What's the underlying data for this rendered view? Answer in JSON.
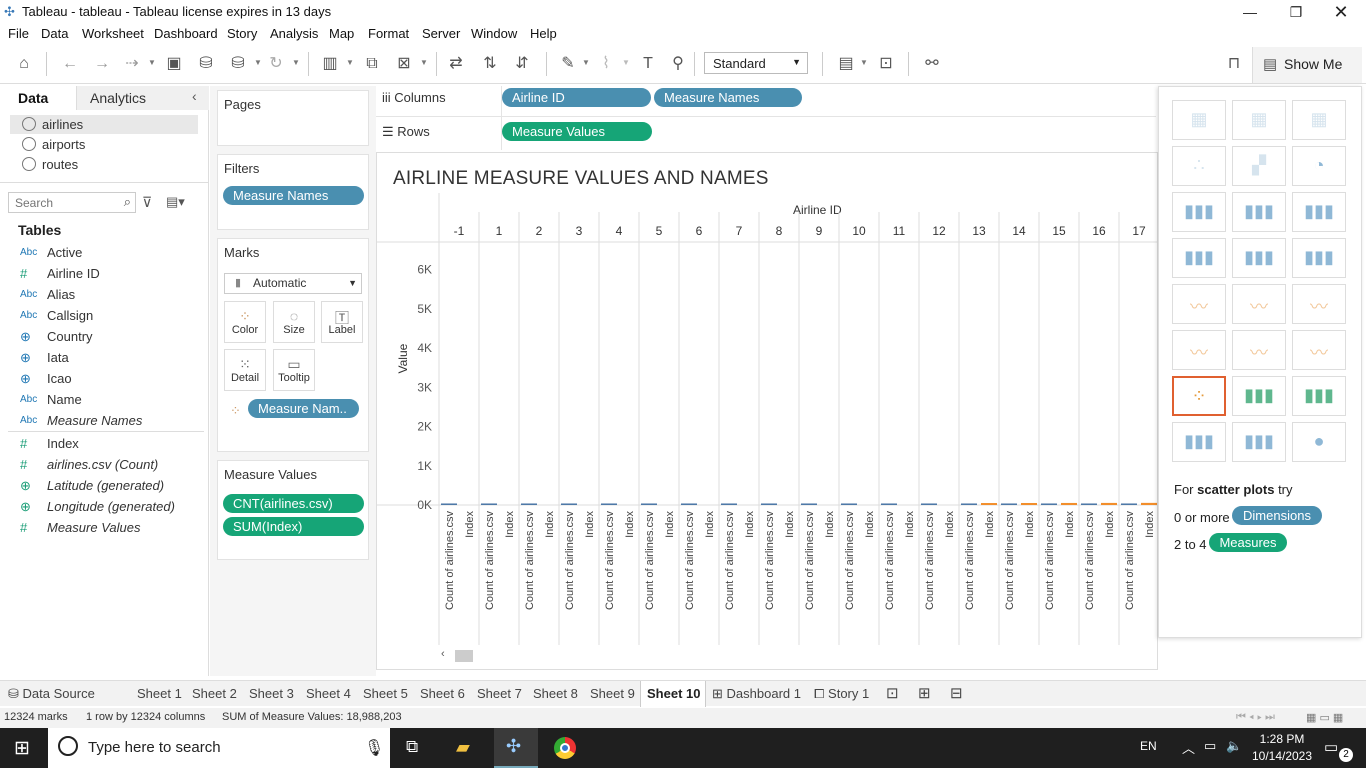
{
  "window": {
    "title": "Tableau - tableau - Tableau license expires in 13 days"
  },
  "menu": [
    "File",
    "Data",
    "Worksheet",
    "Dashboard",
    "Story",
    "Analysis",
    "Map",
    "Format",
    "Server",
    "Window",
    "Help"
  ],
  "toolbar": {
    "fit_select": "Standard",
    "show_me": "Show Me"
  },
  "left_pane": {
    "tabs": [
      "Data",
      "Analytics"
    ],
    "datasources": [
      "airlines",
      "airports",
      "routes"
    ],
    "search_placeholder": "Search",
    "tables_header": "Tables",
    "fields": [
      {
        "type": "Abc",
        "name": "Active",
        "kind": "dim",
        "italic": false
      },
      {
        "type": "#",
        "name": "Airline ID",
        "kind": "mea",
        "italic": false
      },
      {
        "type": "Abc",
        "name": "Alias",
        "kind": "dim",
        "italic": false
      },
      {
        "type": "Abc",
        "name": "Callsign",
        "kind": "dim",
        "italic": false
      },
      {
        "type": "globe",
        "name": "Country",
        "kind": "dim",
        "italic": false
      },
      {
        "type": "globe",
        "name": "Iata",
        "kind": "dim",
        "italic": false
      },
      {
        "type": "globe",
        "name": "Icao",
        "kind": "dim",
        "italic": false
      },
      {
        "type": "Abc",
        "name": "Name",
        "kind": "dim",
        "italic": false
      },
      {
        "type": "Abc",
        "name": "Measure Names",
        "kind": "dim",
        "italic": true
      },
      {
        "type": "#",
        "name": "Index",
        "kind": "mea",
        "italic": false
      },
      {
        "type": "#",
        "name": "airlines.csv (Count)",
        "kind": "mea",
        "italic": true
      },
      {
        "type": "globe",
        "name": "Latitude (generated)",
        "kind": "mea",
        "italic": true
      },
      {
        "type": "globe",
        "name": "Longitude (generated)",
        "kind": "mea",
        "italic": true
      },
      {
        "type": "#",
        "name": "Measure Values",
        "kind": "mea",
        "italic": true
      }
    ]
  },
  "cards": {
    "pages": "Pages",
    "filters": "Filters",
    "filter_pill": "Measure Names",
    "marks": "Marks",
    "mark_type": "Automatic",
    "mark_buttons": [
      "Color",
      "Size",
      "Label",
      "Detail",
      "Tooltip"
    ],
    "marks_pill": "Measure Nam..",
    "measure_values": "Measure Values",
    "mv_pills": [
      "CNT(airlines.csv)",
      "SUM(Index)"
    ]
  },
  "shelves": {
    "columns_label": "Columns",
    "rows_label": "Rows",
    "columns_pills": [
      "Airline ID",
      "Measure Names"
    ],
    "rows_pills": [
      "Measure Values"
    ]
  },
  "view": {
    "title": "AIRLINE MEASURE VALUES AND NAMES"
  },
  "chart_data": {
    "type": "bar",
    "title": "AIRLINE MEASURE VALUES AND NAMES",
    "xlabel": "Airline ID",
    "ylabel": "Value",
    "categories": [
      "-1",
      "1",
      "2",
      "3",
      "4",
      "5",
      "6",
      "7",
      "8",
      "9",
      "10",
      "11",
      "12",
      "13",
      "14",
      "15",
      "16",
      "17"
    ],
    "subcategories": [
      "Count of airlines.csv",
      "Index"
    ],
    "y_ticks": [
      "0K",
      "1K",
      "2K",
      "3K",
      "4K",
      "5K",
      "6K"
    ],
    "ylim": [
      0,
      6500
    ],
    "series": [
      {
        "name": "Count of airlines.csv",
        "values": [
          1,
          1,
          1,
          1,
          1,
          1,
          1,
          1,
          1,
          1,
          1,
          1,
          1,
          1,
          1,
          1,
          1,
          1
        ]
      },
      {
        "name": "Index",
        "values": [
          0,
          0,
          0,
          0,
          0,
          0,
          0,
          0,
          0,
          0,
          0,
          0,
          0,
          12,
          13,
          14,
          15,
          16
        ]
      }
    ]
  },
  "show_me": {
    "hint_prefix": "For",
    "hint_bold": "scatter plots",
    "hint_suffix": "try",
    "dims_prefix": "0 or more",
    "dims_pill": "Dimensions",
    "meas_prefix": "2 to 4",
    "meas_pill": "Measures"
  },
  "sheet_tabs": [
    "Data Source",
    "Sheet 1",
    "Sheet 2",
    "Sheet 3",
    "Sheet 4",
    "Sheet 5",
    "Sheet 6",
    "Sheet 7",
    "Sheet 8",
    "Sheet 9",
    "Sheet 10",
    "Dashboard 1",
    "Story 1"
  ],
  "active_tab": "Sheet 10",
  "status": {
    "marks": "12324 marks",
    "shape": "1 row by 12324 columns",
    "sum": "SUM of Measure Values: 18,988,203"
  },
  "taskbar": {
    "search": "Type here to search",
    "lang": "EN",
    "time": "1:28 PM",
    "date": "10/14/2023",
    "notif": "2"
  }
}
